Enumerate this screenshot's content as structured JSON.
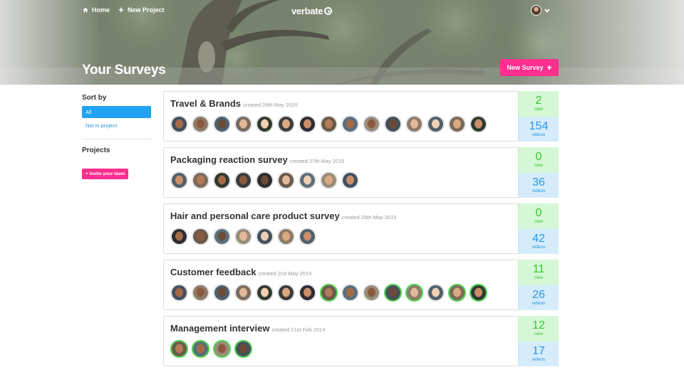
{
  "nav": {
    "home": "Home",
    "new_project": "New Project"
  },
  "brand": {
    "logo": "verbate"
  },
  "hero": {
    "title": "Your Surveys",
    "new_survey": "New Survey"
  },
  "sidebar": {
    "sort_heading": "Sort by",
    "sort_options": [
      {
        "label": "All",
        "active": true
      },
      {
        "label": "Not in project",
        "active": false
      }
    ],
    "projects_heading": "Projects",
    "invite_button": "+ Invite your team"
  },
  "surveys": [
    {
      "title": "Travel & Brands",
      "created": "created 28th May 2015",
      "new_count": "2",
      "new_label": "new",
      "videos_count": "154",
      "videos_label": "videos",
      "respondents": 15,
      "highlighted": []
    },
    {
      "title": "Packaging reaction survey",
      "created": "created 27th May 2015",
      "new_count": "0",
      "new_label": "new",
      "videos_count": "36",
      "videos_label": "videos",
      "respondents": 9,
      "highlighted": []
    },
    {
      "title": "Hair and personal care product survey",
      "created": "created 26th May 2015",
      "new_count": "0",
      "new_label": "new",
      "videos_count": "42",
      "videos_label": "videos",
      "respondents": 7,
      "highlighted": []
    },
    {
      "title": "Customer feedback",
      "created": "created 2nd May 2014",
      "new_count": "11",
      "new_label": "new",
      "videos_count": "26",
      "videos_label": "videos",
      "respondents": 15,
      "highlighted": [
        7,
        10,
        11,
        13,
        14
      ]
    },
    {
      "title": "Management interview",
      "created": "created 21st Feb 2014",
      "new_count": "12",
      "new_label": "new",
      "videos_count": "17",
      "videos_label": "videos",
      "respondents": 4,
      "highlighted": [
        0,
        1,
        2,
        3
      ]
    }
  ],
  "colors": {
    "accent_pink": "#ff2f8f",
    "primary_blue": "#1fa3f2",
    "new_green": "#33c533",
    "videos_blue": "#2596e8"
  },
  "icons": {
    "home": "home-icon",
    "plus": "plus-icon",
    "chevron": "chevron-down-icon"
  }
}
